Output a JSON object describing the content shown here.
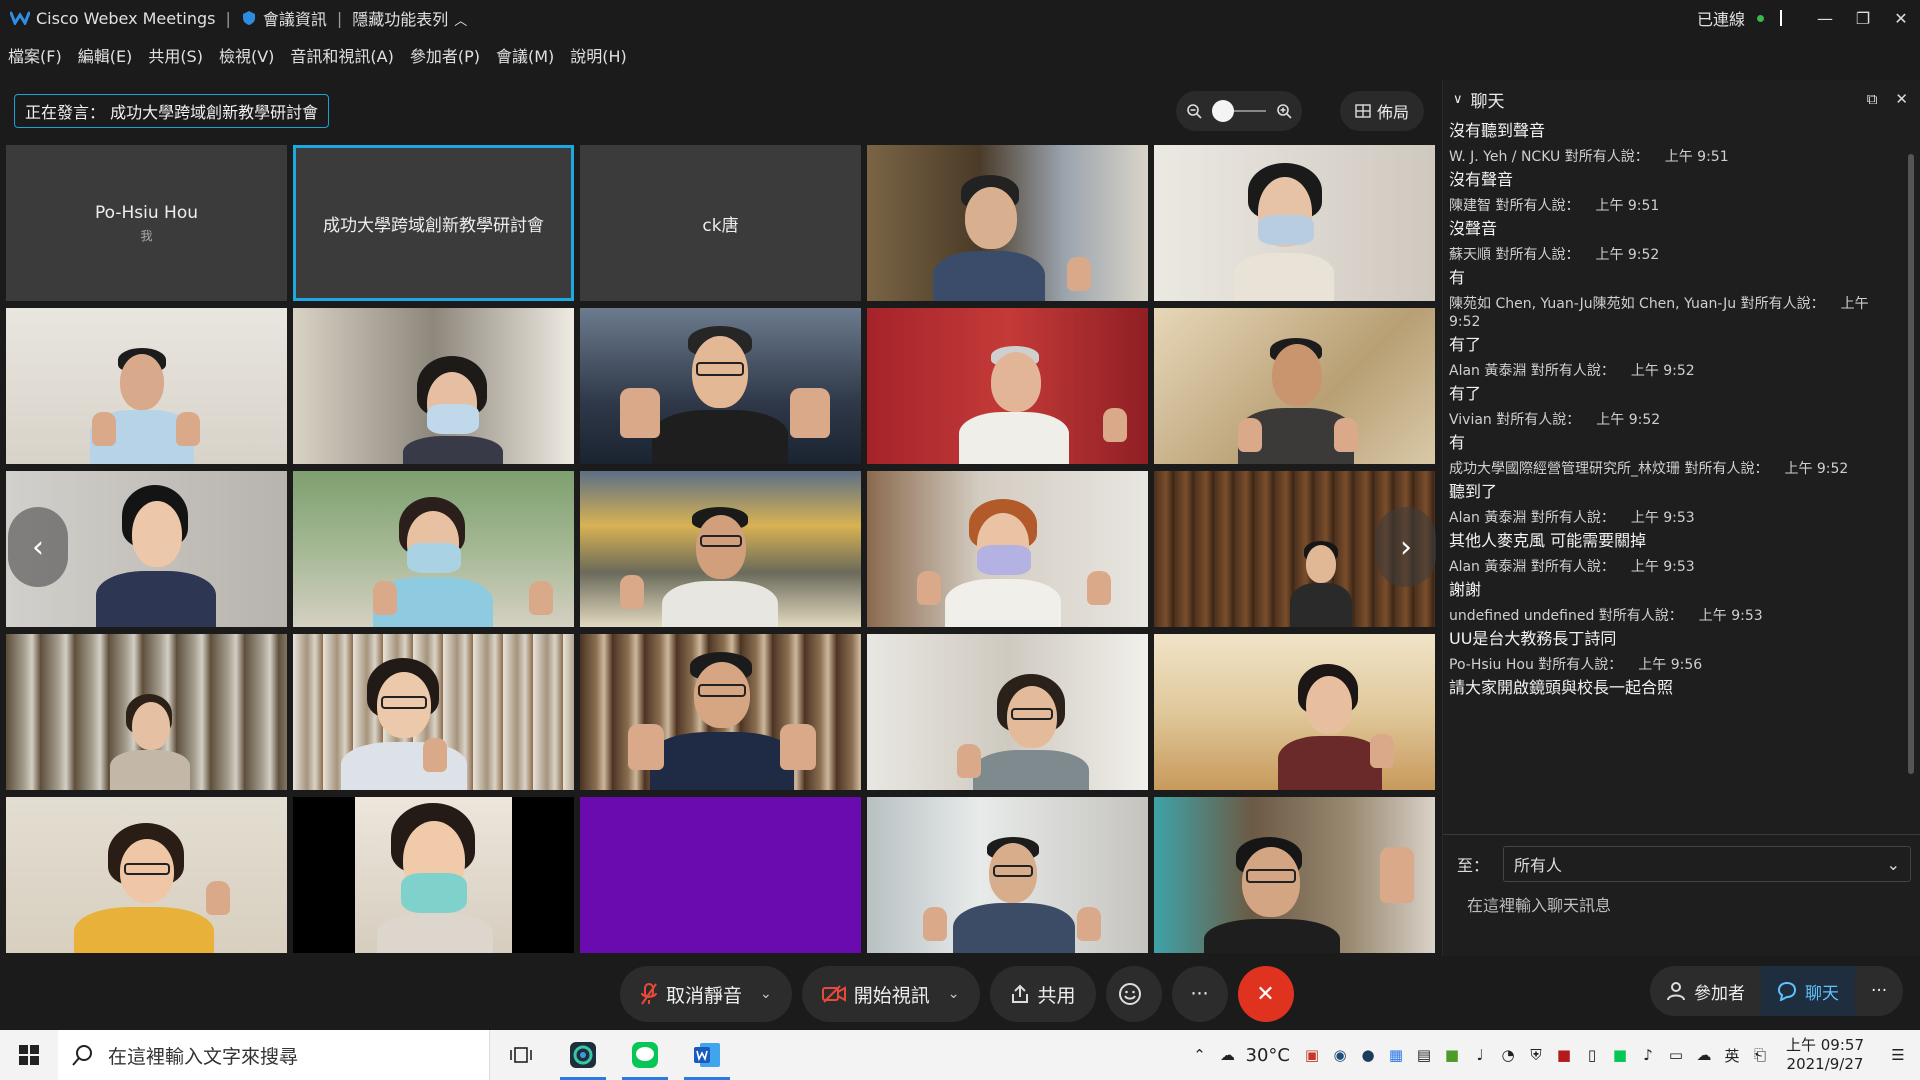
{
  "titlebar": {
    "app_name": "Cisco Webex Meetings",
    "meeting_info": "會議資訊",
    "hide_menu": "隱藏功能表列",
    "status": "已連線"
  },
  "menu": [
    "檔案(F)",
    "編輯(E)",
    "共用(S)",
    "檢視(V)",
    "音訊和視訊(A)",
    "參加者(P)",
    "會議(M)",
    "說明(H)"
  ],
  "speaking": "正在發言： 成功大學跨域創新教學研討會",
  "layout_label": "佈局",
  "tiles": {
    "t1_name": "Po-Hsiu Hou",
    "t1_sub": "我",
    "t2_name": "成功大學跨域創新教學研討會",
    "t3_name": "ck唐"
  },
  "controls": {
    "mute": "取消靜音",
    "video": "開始視訊",
    "share": "共用",
    "more": "···",
    "participants": "參加者",
    "chat": "聊天"
  },
  "chat": {
    "title": "聊天",
    "messages": [
      {
        "meta": "",
        "time": "",
        "text": "沒有聽到聲音"
      },
      {
        "meta": "W. J. Yeh / NCKU 對所有人說：",
        "time": "上午 9:51",
        "text": "沒有聲音"
      },
      {
        "meta": "陳建智 對所有人說：",
        "time": "上午 9:51",
        "text": "沒聲音"
      },
      {
        "meta": "蘇天順 對所有人說：",
        "time": "上午 9:52",
        "text": "有"
      },
      {
        "meta": "陳苑如 Chen, Yuan-Ju陳苑如 Chen, Yuan-Ju 對所有人說：",
        "time": "上午 9:52",
        "text": "有了"
      },
      {
        "meta": "Alan 黃泰淵 對所有人說：",
        "time": "上午 9:52",
        "text": "有了"
      },
      {
        "meta": "Vivian 對所有人說：",
        "time": "上午 9:52",
        "text": "有"
      },
      {
        "meta": "成功大學國際經營管理研究所_林炆珊 對所有人說：",
        "time": "上午 9:52",
        "text": "聽到了"
      },
      {
        "meta": "Alan 黃泰淵 對所有人說：",
        "time": "上午 9:53",
        "text": "其他人麥克風 可能需要關掉"
      },
      {
        "meta": "Alan 黃泰淵 對所有人說：",
        "time": "上午 9:53",
        "text": "謝謝"
      },
      {
        "meta": "undefined undefined 對所有人說：",
        "time": "上午 9:53",
        "text": "UU是台大教務長丁詩同"
      },
      {
        "meta": "Po-Hsiu Hou 對所有人說：",
        "time": "上午 9:56",
        "text": "請大家開啟鏡頭與校長一起合照"
      }
    ],
    "to_label": "至：",
    "to_value": "所有人",
    "input_placeholder": "在這裡輸入聊天訊息"
  },
  "taskbar": {
    "search_placeholder": "在這裡輸入文字來搜尋",
    "temperature": "30°C",
    "ime": "英",
    "time": "上午 09:57",
    "date": "2021/9/27"
  },
  "colors": {
    "accent": "#1da9e0",
    "end_call": "#e0331f",
    "connected": "#3cb84a",
    "purple_tile": "#6a0bb0"
  }
}
